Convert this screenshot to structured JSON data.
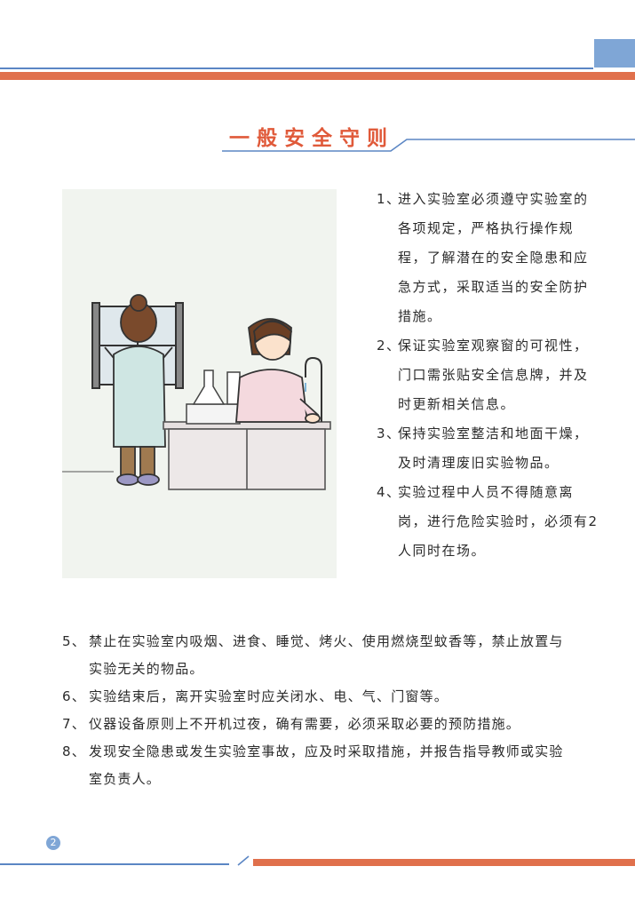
{
  "title": "一般安全守则",
  "page_number": "2",
  "right_items": [
    {
      "num": "1、",
      "text": "进入实验室必须遵守实验室的各项规定，严格执行操作规程，了解潜在的安全隐患和应急方式，采取适当的安全防护措施。"
    },
    {
      "num": "2、",
      "text": "保证实验室观察窗的可视性，门口需张贴安全信息牌，并及时更新相关信息。"
    },
    {
      "num": "3、",
      "text": "保持实验室整洁和地面干燥，及时清理废旧实验物品。"
    },
    {
      "num": "4、",
      "text": "实验过程中人员不得随意离岗，进行危险实验时，必须有2人同时在场。"
    }
  ],
  "bottom_items": [
    {
      "num": "5、",
      "text": "禁止在实验室内吸烟、进食、睡觉、烤火、使用燃烧型蚊香等，禁止放置与实验无关的物品。"
    },
    {
      "num": "6、",
      "text": "实验结束后，离开实验室时应关闭水、电、气、门窗等。"
    },
    {
      "num": "7、",
      "text": "仪器设备原则上不开机过夜，确有需要，必须采取必要的预防措施。"
    },
    {
      "num": "8、",
      "text": "发现安全隐患或发生实验室事故，应及时采取措施，并报告指导教师或实验室负责人。"
    }
  ],
  "colors": {
    "accent_orange": "#e0704c",
    "accent_blue": "#5b86c4",
    "title_red": "#e05a3a"
  }
}
